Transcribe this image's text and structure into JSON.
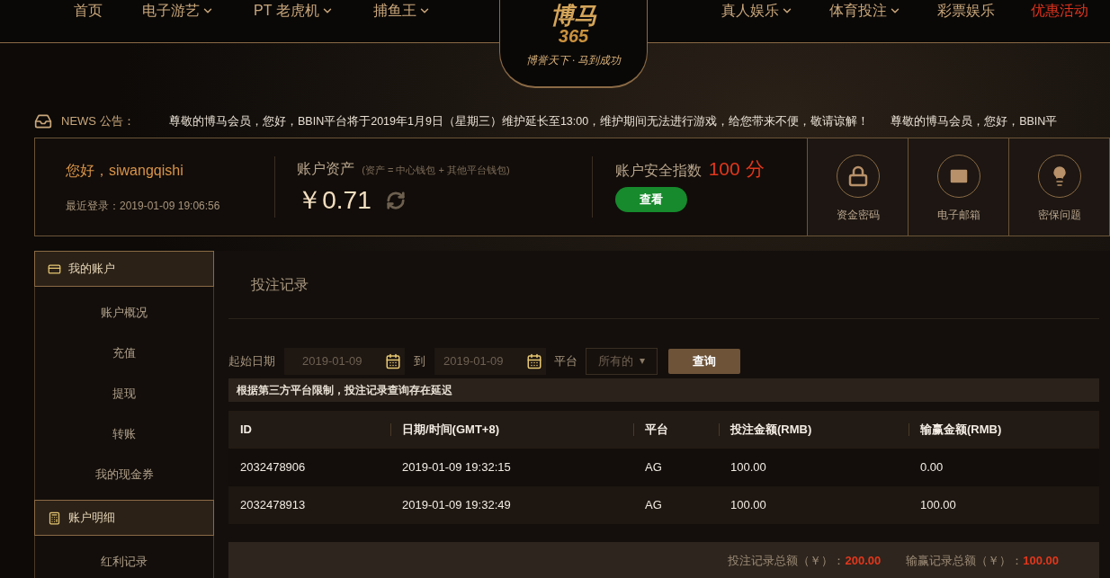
{
  "nav": {
    "left": [
      {
        "label": "首页",
        "dropdown": false,
        "selected": false
      },
      {
        "label": "电子游艺",
        "dropdown": true,
        "selected": false
      },
      {
        "label": "PT 老虎机",
        "dropdown": true,
        "selected": false
      },
      {
        "label": "捕鱼王",
        "dropdown": true,
        "selected": false
      }
    ],
    "right": [
      {
        "label": "真人娱乐",
        "dropdown": true,
        "selected": false
      },
      {
        "label": "体育投注",
        "dropdown": true,
        "selected": false
      },
      {
        "label": "彩票娱乐",
        "dropdown": false,
        "selected": false
      },
      {
        "label": "优惠活动",
        "dropdown": false,
        "selected": true
      }
    ]
  },
  "logo": {
    "name": "博马",
    "number": "365",
    "slogan": "博誉天下 · 马到成功"
  },
  "news": {
    "label": "NEWS 公告：",
    "messages": [
      "尊敬的博马会员，您好，BBIN平台将于2019年1月9日（星期三）维护延长至13:00，维护期间无法进行游戏，给您带来不便，敬请谅解！",
      "尊敬的博马会员，您好，BBIN平"
    ]
  },
  "account": {
    "greeting": "您好，siwangqishi",
    "last_login": "最近登录：2019-01-09 19:06:56",
    "assets_label": "账户资产",
    "assets_note": "(资产 = 中心钱包 + 其他平台钱包)",
    "balance": "￥0.71",
    "security_label": "账户安全指数",
    "security_score": "100",
    "security_unit": "分",
    "view_button": "查看",
    "tiles": [
      {
        "kind": "lock",
        "label": "资金密码"
      },
      {
        "kind": "mail",
        "label": "电子邮箱"
      },
      {
        "kind": "bulb",
        "label": "密保问题"
      }
    ]
  },
  "sidebar": [
    {
      "title": "我的账户",
      "kind": "card",
      "items": [
        "账户概况",
        "充值",
        "提现",
        "转账",
        "我的现金券"
      ]
    },
    {
      "title": "账户明细",
      "kind": "calculator",
      "items": [
        "红利记录"
      ]
    }
  ],
  "main": {
    "title": "投注记录",
    "filter": {
      "start_label": "起始日期",
      "start_value": "2019-01-09",
      "to_label": "到",
      "end_value": "2019-01-09",
      "platform_label": "平台",
      "platform_value": "所有的",
      "query_button": "查询"
    },
    "notice": "根据第三方平台限制，投注记录查询存在延迟",
    "table": {
      "columns": [
        "ID",
        "日期/时间(GMT+8)",
        "平台",
        "投注金额(RMB)",
        "输赢金额(RMB)"
      ],
      "rows": [
        [
          "2032478906",
          "2019-01-09 19:32:15",
          "AG",
          "100.00",
          "0.00"
        ],
        [
          "2032478913",
          "2019-01-09 19:32:49",
          "AG",
          "100.00",
          "100.00"
        ]
      ]
    },
    "totals": [
      {
        "label": "投注记录总额（￥）：",
        "value": "200.00"
      },
      {
        "label": "输赢记录总额（￥）：",
        "value": "100.00"
      }
    ]
  }
}
